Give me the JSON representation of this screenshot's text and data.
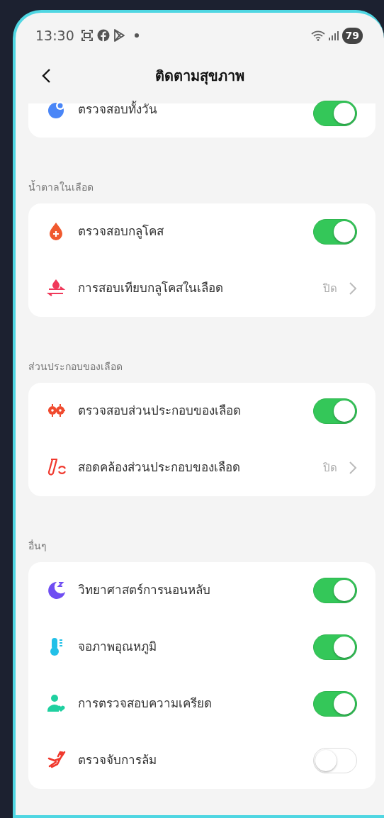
{
  "status_bar": {
    "time": "13:30",
    "battery": "79"
  },
  "header": {
    "title": "ติดตามสุขภาพ"
  },
  "sections": [
    {
      "items": [
        {
          "kind": "toggle",
          "label": "ตรวจสอบทั้งวัน",
          "on": true
        }
      ]
    },
    {
      "title": "น้ำตาลในเลือด",
      "items": [
        {
          "kind": "toggle",
          "label": "ตรวจสอบกลูโคส",
          "on": true
        },
        {
          "kind": "link",
          "label": "การสอบเทียบกลูโคสในเลือด",
          "value": "ปิด"
        }
      ]
    },
    {
      "title": "ส่วนประกอบของเลือด",
      "items": [
        {
          "kind": "toggle",
          "label": "ตรวจสอบส่วนประกอบของเลือด",
          "on": true
        },
        {
          "kind": "link",
          "label": "สอดคล้องส่วนประกอบของเลือด",
          "value": "ปิด"
        }
      ]
    },
    {
      "title": "อื่นๆ",
      "items": [
        {
          "kind": "toggle",
          "label": "วิทยาศาสตร์การนอนหลับ",
          "on": true
        },
        {
          "kind": "toggle",
          "label": "จอภาพอุณหภูมิ",
          "on": true
        },
        {
          "kind": "toggle",
          "label": "การตรวจสอบความเครียด",
          "on": true
        },
        {
          "kind": "toggle",
          "label": "ตรวจจับการล้ม",
          "on": false
        }
      ]
    }
  ]
}
